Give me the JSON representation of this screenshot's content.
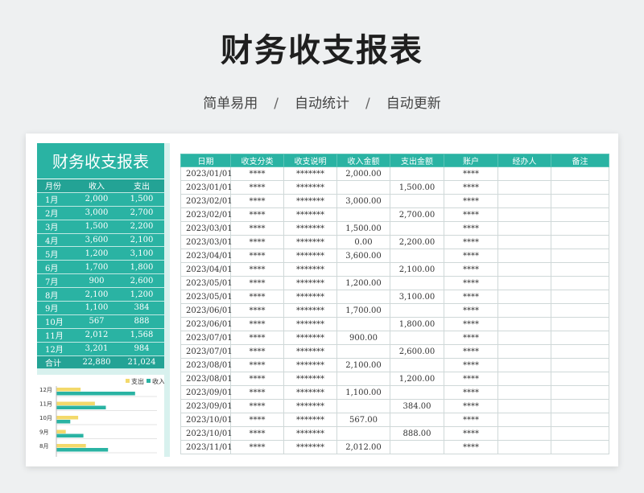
{
  "title": "财务收支报表",
  "subtitle": {
    "parts": [
      "简单易用",
      "自动统计",
      "自动更新"
    ],
    "separator": "/"
  },
  "colors": {
    "teal": "#2ab3a3",
    "yellow": "#f3d96b",
    "panel_bg": "#d8f1ee"
  },
  "summary": {
    "title": "财务收支报表",
    "headers": [
      "月份",
      "收入",
      "支出"
    ],
    "rows": [
      {
        "month": "1月",
        "income": "2,000",
        "expense": "1,500"
      },
      {
        "month": "2月",
        "income": "3,000",
        "expense": "2,700"
      },
      {
        "month": "3月",
        "income": "1,500",
        "expense": "2,200"
      },
      {
        "month": "4月",
        "income": "3,600",
        "expense": "2,100"
      },
      {
        "month": "5月",
        "income": "1,200",
        "expense": "3,100"
      },
      {
        "month": "6月",
        "income": "1,700",
        "expense": "1,800"
      },
      {
        "month": "7月",
        "income": "900",
        "expense": "2,600"
      },
      {
        "month": "8月",
        "income": "2,100",
        "expense": "1,200"
      },
      {
        "month": "9月",
        "income": "1,100",
        "expense": "384"
      },
      {
        "month": "10月",
        "income": "567",
        "expense": "888"
      },
      {
        "month": "11月",
        "income": "2,012",
        "expense": "1,568"
      },
      {
        "month": "12月",
        "income": "3,201",
        "expense": "984"
      }
    ],
    "total": {
      "month": "合计",
      "income": "22,880",
      "expense": "21,024"
    }
  },
  "chart_data": {
    "type": "bar",
    "orientation": "horizontal",
    "legend": [
      "支出",
      "收入"
    ],
    "legend_position": "top-right",
    "categories": [
      "12月",
      "11月",
      "10月",
      "9月",
      "8月"
    ],
    "series": [
      {
        "name": "支出",
        "color": "#f3d96b",
        "values": [
          984,
          1568,
          888,
          384,
          1200
        ]
      },
      {
        "name": "收入",
        "color": "#2ab3a3",
        "values": [
          3201,
          2012,
          567,
          1100,
          2100
        ]
      }
    ]
  },
  "ledger": {
    "headers": [
      "日期",
      "收支分类",
      "收支说明",
      "收入金额",
      "支出金额",
      "账户",
      "经办人",
      "备注"
    ],
    "rows": [
      [
        "2023/01/01",
        "****",
        "*******",
        "2,000.00",
        "",
        "****",
        "",
        ""
      ],
      [
        "2023/01/01",
        "****",
        "*******",
        "",
        "1,500.00",
        "****",
        "",
        ""
      ],
      [
        "2023/02/01",
        "****",
        "*******",
        "3,000.00",
        "",
        "****",
        "",
        ""
      ],
      [
        "2023/02/01",
        "****",
        "*******",
        "",
        "2,700.00",
        "****",
        "",
        ""
      ],
      [
        "2023/03/01",
        "****",
        "*******",
        "1,500.00",
        "",
        "****",
        "",
        ""
      ],
      [
        "2023/03/01",
        "****",
        "*******",
        "0.00",
        "2,200.00",
        "****",
        "",
        ""
      ],
      [
        "2023/04/01",
        "****",
        "*******",
        "3,600.00",
        "",
        "****",
        "",
        ""
      ],
      [
        "2023/04/01",
        "****",
        "*******",
        "",
        "2,100.00",
        "****",
        "",
        ""
      ],
      [
        "2023/05/01",
        "****",
        "*******",
        "1,200.00",
        "",
        "****",
        "",
        ""
      ],
      [
        "2023/05/01",
        "****",
        "*******",
        "",
        "3,100.00",
        "****",
        "",
        ""
      ],
      [
        "2023/06/01",
        "****",
        "*******",
        "1,700.00",
        "",
        "****",
        "",
        ""
      ],
      [
        "2023/06/01",
        "****",
        "*******",
        "",
        "1,800.00",
        "****",
        "",
        ""
      ],
      [
        "2023/07/01",
        "****",
        "*******",
        "900.00",
        "",
        "****",
        "",
        ""
      ],
      [
        "2023/07/01",
        "****",
        "*******",
        "",
        "2,600.00",
        "****",
        "",
        ""
      ],
      [
        "2023/08/01",
        "****",
        "*******",
        "2,100.00",
        "",
        "****",
        "",
        ""
      ],
      [
        "2023/08/01",
        "****",
        "*******",
        "",
        "1,200.00",
        "****",
        "",
        ""
      ],
      [
        "2023/09/01",
        "****",
        "*******",
        "1,100.00",
        "",
        "****",
        "",
        ""
      ],
      [
        "2023/09/01",
        "****",
        "*******",
        "",
        "384.00",
        "****",
        "",
        ""
      ],
      [
        "2023/10/01",
        "****",
        "*******",
        "567.00",
        "",
        "****",
        "",
        ""
      ],
      [
        "2023/10/01",
        "****",
        "*******",
        "",
        "888.00",
        "****",
        "",
        ""
      ],
      [
        "2023/11/01",
        "****",
        "*******",
        "2,012.00",
        "",
        "****",
        "",
        ""
      ]
    ]
  }
}
